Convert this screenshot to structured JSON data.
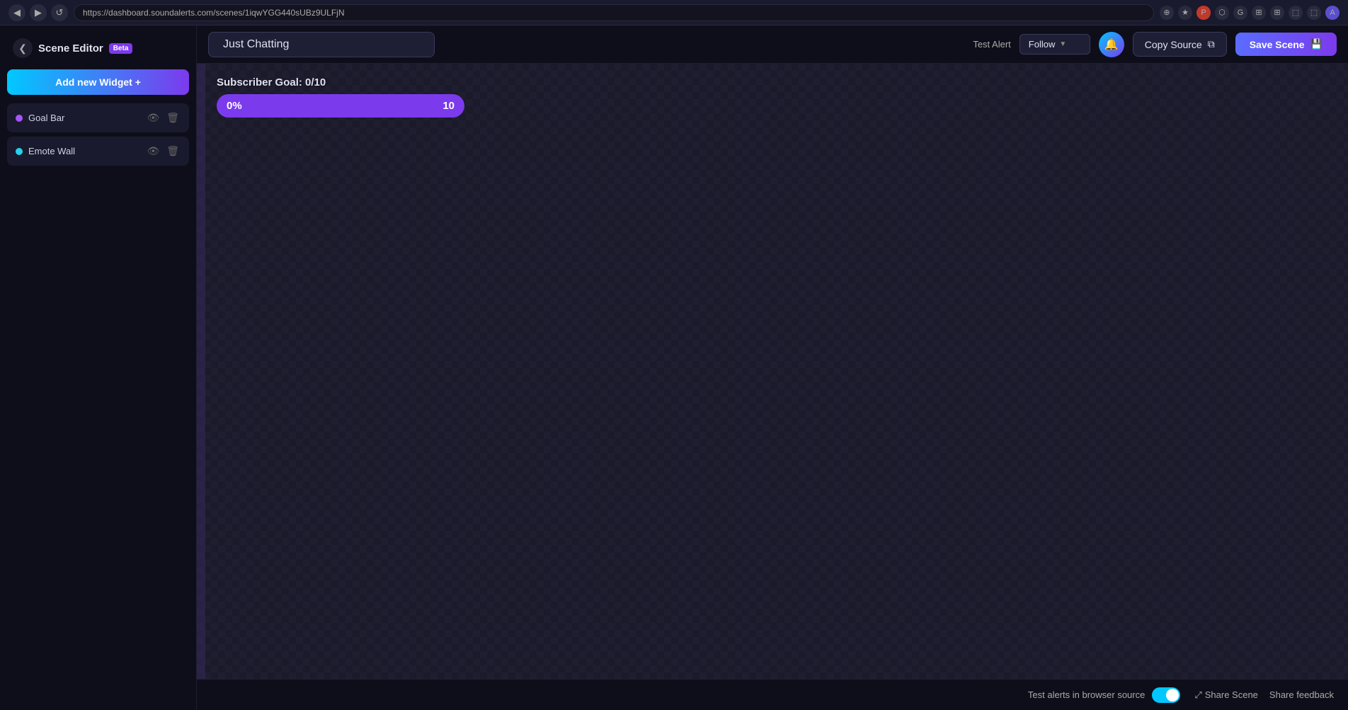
{
  "browser": {
    "url": "https://dashboard.soundalerts.com/scenes/1iqwYGG440sUBz9ULFjN",
    "back_label": "◀",
    "forward_label": "▶",
    "reload_label": "↺"
  },
  "sidebar": {
    "title": "Scene Editor",
    "beta_label": "Beta",
    "add_widget_label": "Add new Widget +",
    "back_label": "❮",
    "widgets": [
      {
        "name": "Goal Bar",
        "dot_class": "goal"
      },
      {
        "name": "Emote Wall",
        "dot_class": "emote"
      }
    ]
  },
  "toolbar": {
    "scene_name": "Just Chatting",
    "test_alert_label": "Test Alert",
    "follow_label": "Follow",
    "bell_icon": "🔔",
    "copy_source_label": "Copy Source",
    "copy_icon": "⧉",
    "save_scene_label": "Save Scene",
    "save_icon": "💾"
  },
  "canvas": {
    "goal_widget": {
      "title": "Subscriber Goal: 0/10",
      "percent": "0%",
      "count": "10",
      "fill_width": "0"
    }
  },
  "bottom_bar": {
    "test_alerts_label": "Test alerts in browser source",
    "share_scene_label": "Share Scene",
    "share_scene_icon": "⤢",
    "share_feedback_label": "Share feedback"
  }
}
